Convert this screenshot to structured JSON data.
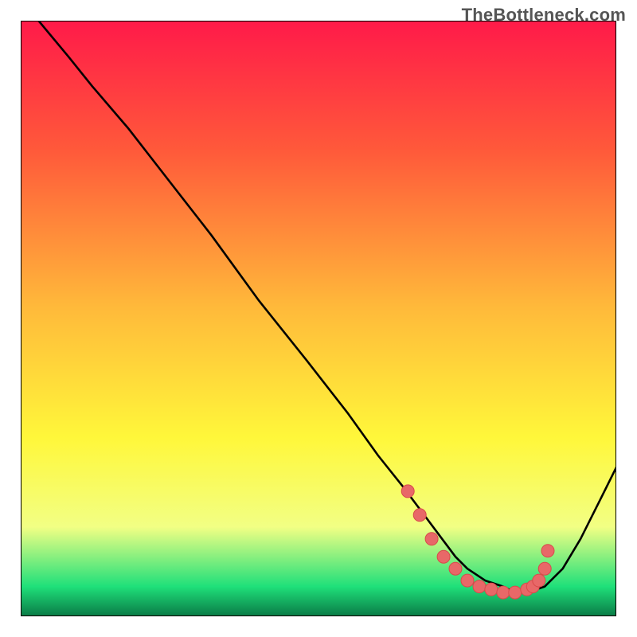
{
  "watermark": "TheBottleneck.com",
  "colors": {
    "gradient_top": "#ff1a49",
    "gradient_mid1": "#ff5a3a",
    "gradient_mid2": "#ffb93a",
    "gradient_mid3": "#fff73a",
    "gradient_low": "#f2ff84",
    "gradient_green": "#1fe07a",
    "gradient_bottom_dark": "#0a7a46",
    "curve": "#000000",
    "dot_fill": "#e86868",
    "dot_stroke": "#d84a4a",
    "border": "#000000"
  },
  "chart_data": {
    "type": "line",
    "title": "",
    "xlabel": "",
    "ylabel": "",
    "xlim": [
      0,
      100
    ],
    "ylim": [
      0,
      100
    ],
    "grid": false,
    "legend": "none",
    "series": [
      {
        "name": "curve",
        "x": [
          3,
          8,
          12,
          18,
          25,
          32,
          40,
          48,
          55,
          60,
          64,
          67,
          70,
          73,
          75,
          78,
          81,
          83,
          85,
          88,
          91,
          94,
          97,
          100
        ],
        "y": [
          100,
          94,
          89,
          82,
          73,
          64,
          53,
          43,
          34,
          27,
          22,
          18,
          14,
          10,
          8,
          6,
          5,
          4,
          4,
          5,
          8,
          13,
          19,
          25
        ]
      }
    ],
    "marker_points": {
      "name": "dots",
      "x": [
        65,
        67,
        69,
        71,
        73,
        75,
        77,
        79,
        81,
        83,
        85,
        86,
        87,
        88,
        88.5
      ],
      "y": [
        21,
        17,
        13,
        10,
        8,
        6,
        5,
        4.5,
        4,
        4,
        4.5,
        5,
        6,
        8,
        11
      ]
    }
  }
}
